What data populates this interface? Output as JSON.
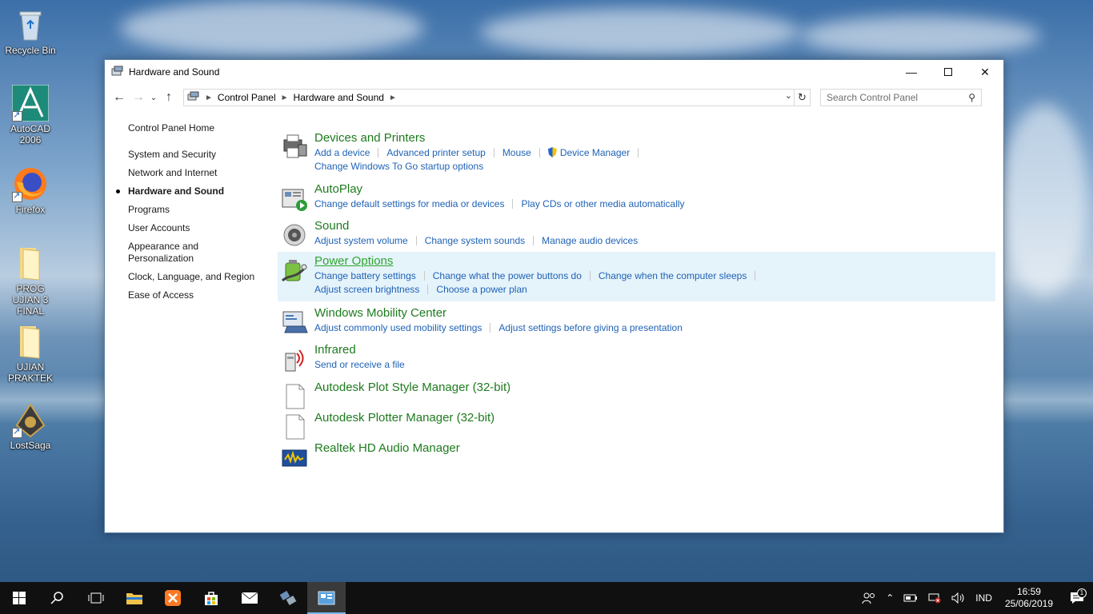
{
  "desktop": {
    "icons": [
      {
        "label": "Recycle Bin"
      },
      {
        "label": "AutoCAD 2006"
      },
      {
        "label": "Firefox"
      },
      {
        "label": "PROG UJIAN 3 FINAL"
      },
      {
        "label": "UJIAN PRAKTEK"
      },
      {
        "label": "LostSaga"
      }
    ]
  },
  "window": {
    "title": "Hardware and Sound",
    "address": {
      "crumbs": [
        "Control Panel",
        "Hardware and Sound"
      ]
    },
    "search": {
      "placeholder": "Search Control Panel"
    },
    "sidebar": {
      "home": "Control Panel Home",
      "items": [
        {
          "label": "System and Security"
        },
        {
          "label": "Network and Internet"
        },
        {
          "label": "Hardware and Sound",
          "current": true
        },
        {
          "label": "Programs"
        },
        {
          "label": "User Accounts"
        },
        {
          "label": "Appearance and Personalization"
        },
        {
          "label": "Clock, Language, and Region"
        },
        {
          "label": "Ease of Access"
        }
      ]
    },
    "categories": [
      {
        "title": "Devices and Printers",
        "links": [
          "Add a device",
          "Advanced printer setup",
          "Mouse",
          "Device Manager",
          "Change Windows To Go startup options"
        ]
      },
      {
        "title": "AutoPlay",
        "links": [
          "Change default settings for media or devices",
          "Play CDs or other media automatically"
        ]
      },
      {
        "title": "Sound",
        "links": [
          "Adjust system volume",
          "Change system sounds",
          "Manage audio devices"
        ]
      },
      {
        "title": "Power Options",
        "links": [
          "Change battery settings",
          "Change what the power buttons do",
          "Change when the computer sleeps",
          "Adjust screen brightness",
          "Choose a power plan"
        ]
      },
      {
        "title": "Windows Mobility Center",
        "links": [
          "Adjust commonly used mobility settings",
          "Adjust settings before giving a presentation"
        ]
      },
      {
        "title": "Infrared",
        "links": [
          "Send or receive a file"
        ]
      },
      {
        "title": "Autodesk Plot Style Manager (32-bit)",
        "links": []
      },
      {
        "title": "Autodesk Plotter Manager (32-bit)",
        "links": []
      },
      {
        "title": "Realtek HD Audio Manager",
        "links": []
      }
    ]
  },
  "taskbar": {
    "language": "IND",
    "time": "16:59",
    "date": "25/06/2019",
    "notification_count": "1"
  },
  "colors": {
    "category_title": "#1e7b1e",
    "link": "#1f62b5",
    "highlight_bg": "#e5f3fb",
    "taskbar": "#101010"
  }
}
